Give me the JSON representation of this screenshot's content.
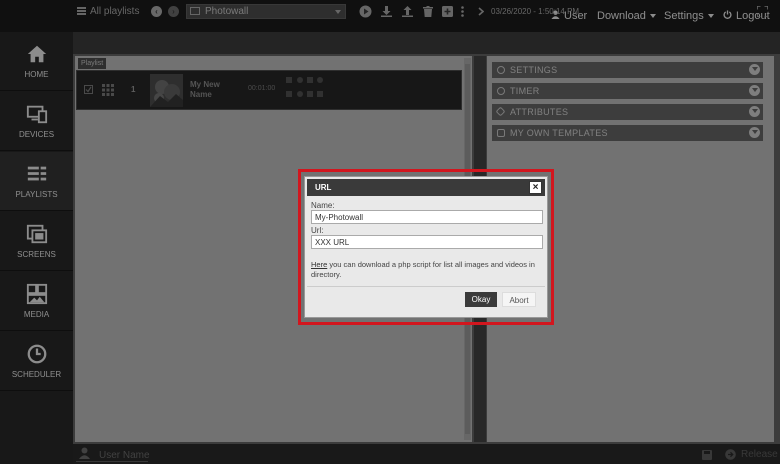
{
  "topbar": {
    "user_label": "User",
    "download_label": "Download",
    "settings_label": "Settings",
    "logout_label": "Logout"
  },
  "sidebar": {
    "items": [
      {
        "label": "HOME",
        "icon": "home-icon"
      },
      {
        "label": "DEVICES",
        "icon": "devices-icon"
      },
      {
        "label": "PLAYLISTS",
        "icon": "playlists-icon",
        "active": true
      },
      {
        "label": "SCREENS",
        "icon": "screens-icon"
      },
      {
        "label": "MEDIA",
        "icon": "media-icon"
      },
      {
        "label": "SCHEDULER",
        "icon": "clock-icon"
      }
    ]
  },
  "toolbar": {
    "all_playlists_label": "All playlists",
    "selected_playlist": "Photowall",
    "datetime": "03/26/2020 - 1:50:14 PM"
  },
  "playlist": {
    "section_label": "Playlist",
    "row": {
      "index": "1",
      "name": "My New Name",
      "duration": "00:01:00"
    }
  },
  "right_panel": {
    "sections": [
      "SETTINGS",
      "TIMER",
      "ATTRIBUTES",
      "MY OWN TEMPLATES"
    ]
  },
  "bottombar": {
    "user_name": "User Name",
    "release_label": "Release"
  },
  "modal": {
    "title": "URL",
    "name_label": "Name:",
    "name_value": "My-Photowall",
    "url_label": "Url:",
    "url_value": "XXX URL",
    "help_link": "Here",
    "help_text": " you can download a php script for list all images and videos in directory.",
    "ok_label": "Okay",
    "abort_label": "Abort"
  },
  "colors": {
    "highlight": "#d2161e",
    "topbar": "#1e1e1e",
    "sidebar": "#2c2c2c"
  }
}
